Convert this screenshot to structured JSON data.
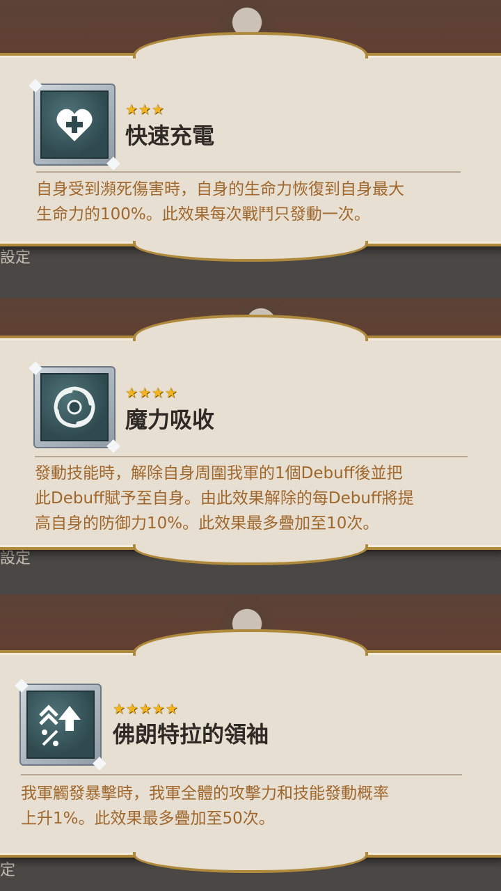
{
  "cards": [
    {
      "stars": "★★★",
      "star_count": 3,
      "name": "快速充電",
      "icon": "heart-plus-icon",
      "desc_lines": [
        "自身受到瀕死傷害時，自身的生命力恢復到自身最大",
        "生命力的100%。此效果每次戰鬥只發動一次。"
      ]
    },
    {
      "stars": "★★★★",
      "star_count": 4,
      "name": "魔力吸收",
      "icon": "vortex-icon",
      "desc_lines": [
        "發動技能時，解除自身周圍我軍的1個Debuff後並把",
        "此Debuff賦予至自身。由此效果解除的每Debuff將提",
        "高自身的防御力10%。此效果最多疊加至10次。"
      ]
    },
    {
      "stars": "★★★★★",
      "star_count": 5,
      "name": "佛朗特拉的領袖",
      "icon": "crit-up-icon",
      "desc_lines": [
        "我軍觸發暴擊時，我軍全體的攻擊力和技能發動概率",
        "上升1%。此效果最多疊加至50次。"
      ]
    }
  ],
  "background_peek": {
    "left_label_1": "設定",
    "left_label_2": "設定",
    "left_label_3": "定"
  },
  "colors": {
    "panel": "#e6dfd2",
    "gold_border": "#b08a3c",
    "desc_text": "#a0672c",
    "name_text": "#2f2a25",
    "star": "#f2b51f"
  }
}
